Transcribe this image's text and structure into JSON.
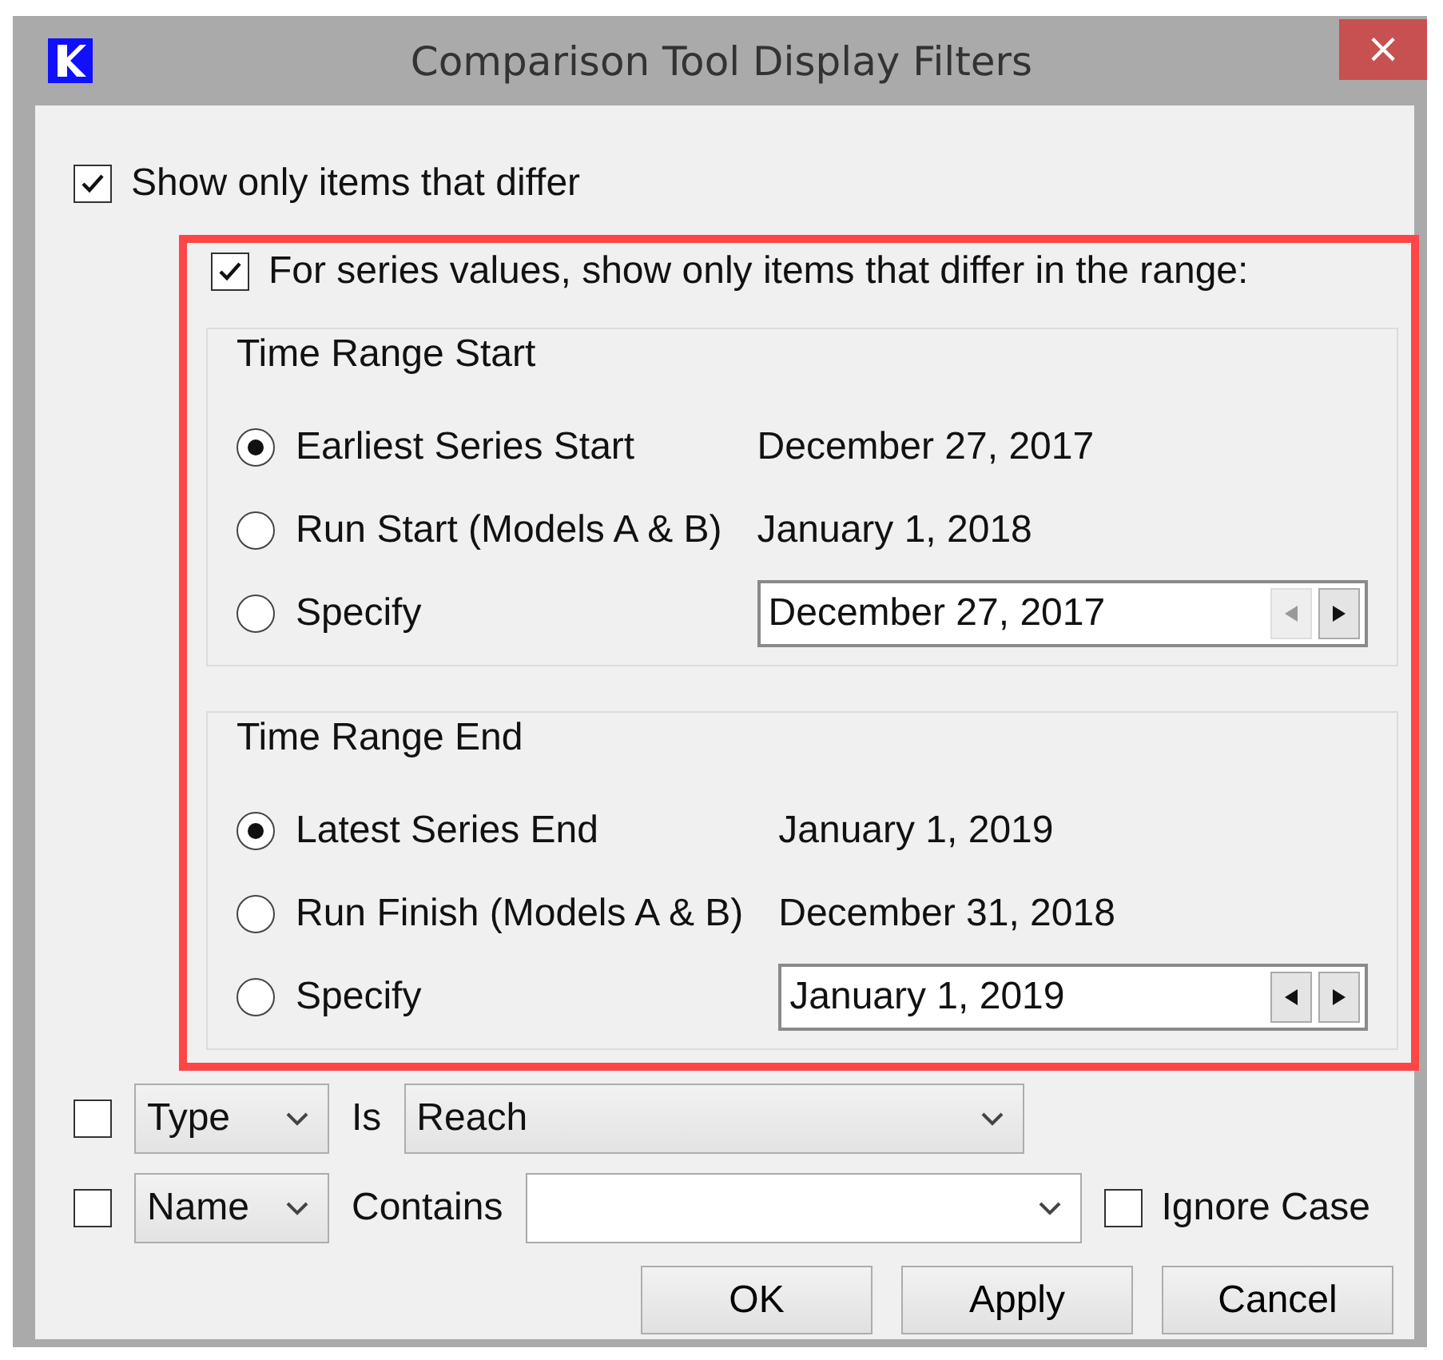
{
  "window": {
    "title": "Comparison Tool Display Filters",
    "close_label": "×"
  },
  "show_only_differ": {
    "label": "Show only items that differ",
    "checked": true
  },
  "series_range": {
    "label": "For series values, show only items that differ in the range:",
    "checked": true,
    "highlighted": true,
    "groups": [
      {
        "title": "Time Range Start",
        "options": [
          {
            "kind": "fixed",
            "label": "Earliest Series Start",
            "value": "December 27, 2017",
            "selected": true
          },
          {
            "kind": "fixed",
            "label": "Run Start (Models A & B)",
            "value": "January 1, 2018",
            "selected": false
          },
          {
            "kind": "spinner",
            "label": "Specify",
            "value": "December 27, 2017",
            "selected": false,
            "prev_disabled": true,
            "next_disabled": false
          }
        ]
      },
      {
        "title": "Time Range End",
        "options": [
          {
            "kind": "fixed",
            "label": "Latest Series End",
            "value": "January 1, 2019",
            "selected": true
          },
          {
            "kind": "fixed",
            "label": "Run Finish (Models A & B)",
            "value": "December 31, 2018",
            "selected": false
          },
          {
            "kind": "spinner",
            "label": "Specify",
            "value": "January 1, 2019",
            "selected": false,
            "prev_disabled": false,
            "next_disabled": false
          }
        ]
      }
    ]
  },
  "filters": [
    {
      "kind": "combo",
      "checked": false,
      "field": "Type",
      "operator": "Is",
      "value": "Reach"
    },
    {
      "kind": "editable",
      "checked": false,
      "field": "Name",
      "operator": "Contains",
      "ignore_case": {
        "label": "Ignore Case",
        "checked": false
      }
    }
  ],
  "buttons": [
    "OK",
    "Apply",
    "Cancel"
  ]
}
